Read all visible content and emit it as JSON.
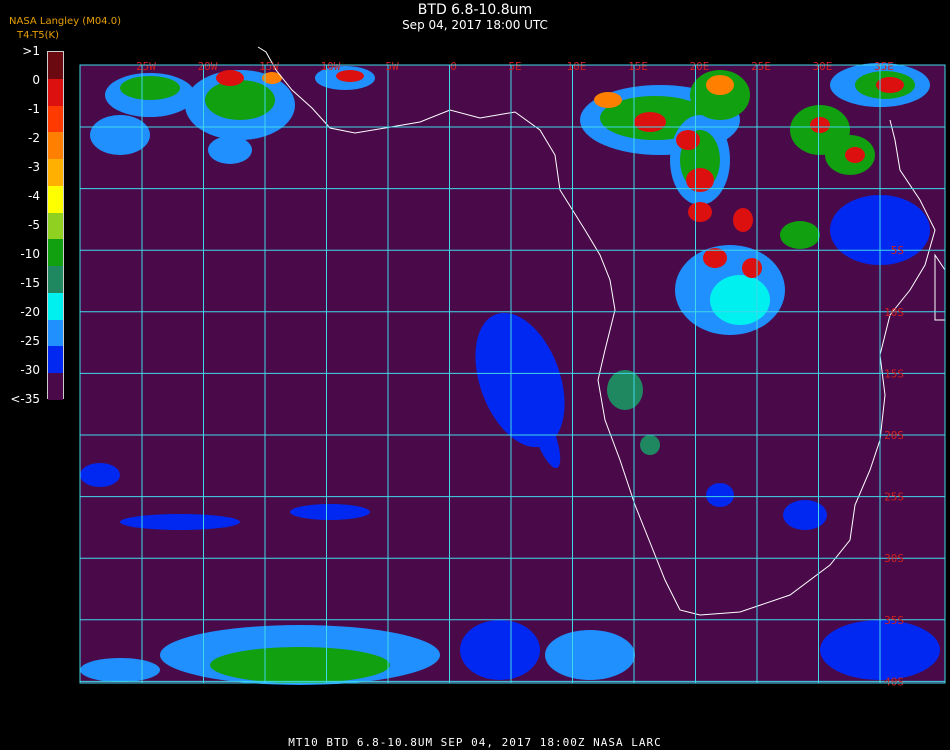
{
  "header": {
    "title": "BTD 6.8-10.8um",
    "subtitle": "Sep 04, 2017 18:00 UTC",
    "credit": "NASA Langley (M04.0)",
    "units": "T4-T5(K)"
  },
  "legend": {
    "labels": [
      ">1",
      "0",
      "-1",
      "-2",
      "-3",
      "-4",
      "-5",
      "-10",
      "-15",
      "-20",
      "-25",
      "-30",
      "<-35"
    ],
    "colors": [
      "#6a0a10",
      "#dd1010",
      "#ff3a00",
      "#ff8000",
      "#ffb000",
      "#ffff00",
      "#90d020",
      "#10a010",
      "#208860",
      "#00f0f0",
      "#2090ff",
      "#0028f0",
      "#4a0a4a"
    ]
  },
  "map": {
    "background": "#4a0a4a",
    "grid_color": "#40d8e8",
    "label_color": "#d02020",
    "lon_labels": [
      "25W",
      "20W",
      "15W",
      "10W",
      "5W",
      "0",
      "5E",
      "10E",
      "15E",
      "20E",
      "25E",
      "30E",
      "35E"
    ],
    "lat_labels": [
      "5S",
      "10S",
      "15S",
      "20S",
      "25S",
      "30S",
      "35S",
      "40S"
    ]
  },
  "footer": "MT10  BTD 6.8-10.8UM   SEP 04, 2017 18:00Z   NASA LARC"
}
